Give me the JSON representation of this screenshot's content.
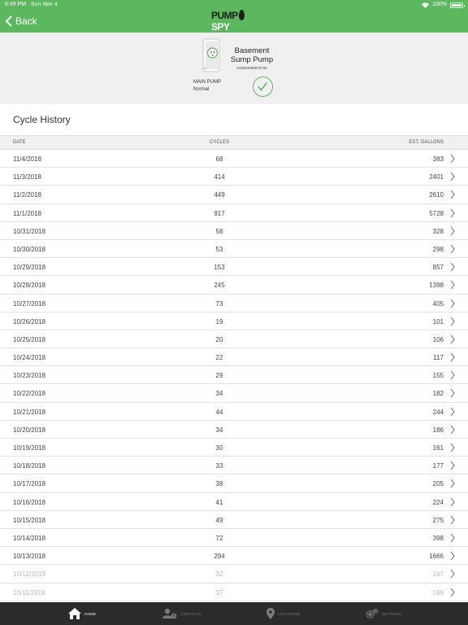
{
  "status_bar": {
    "time": "6:49 PM",
    "date": "Sun Nov 4",
    "battery": "100%"
  },
  "nav": {
    "back_label": "Back",
    "logo_left": "PUMP",
    "logo_right": "SPY"
  },
  "device": {
    "name": "Basement Sump Pump",
    "serial": "216051098975728",
    "pump_label": "MAIN PUMP",
    "pump_status": "Normal"
  },
  "section": {
    "title": "Cycle History"
  },
  "columns": {
    "date": "DATE",
    "cycles": "CYCLES",
    "gallons": "EST. GALLONS"
  },
  "rows": [
    {
      "date": "11/4/2018",
      "cycles": "68",
      "gallons": "383"
    },
    {
      "date": "11/3/2018",
      "cycles": "414",
      "gallons": "2401"
    },
    {
      "date": "11/2/2018",
      "cycles": "449",
      "gallons": "2610"
    },
    {
      "date": "11/1/2018",
      "cycles": "917",
      "gallons": "5728"
    },
    {
      "date": "10/31/2018",
      "cycles": "58",
      "gallons": "328"
    },
    {
      "date": "10/30/2018",
      "cycles": "53",
      "gallons": "298"
    },
    {
      "date": "10/29/2018",
      "cycles": "153",
      "gallons": "857"
    },
    {
      "date": "10/28/2018",
      "cycles": "245",
      "gallons": "1398"
    },
    {
      "date": "10/27/2018",
      "cycles": "73",
      "gallons": "405"
    },
    {
      "date": "10/26/2018",
      "cycles": "19",
      "gallons": "101"
    },
    {
      "date": "10/25/2018",
      "cycles": "20",
      "gallons": "106"
    },
    {
      "date": "10/24/2018",
      "cycles": "22",
      "gallons": "117"
    },
    {
      "date": "10/23/2018",
      "cycles": "29",
      "gallons": "155"
    },
    {
      "date": "10/22/2018",
      "cycles": "34",
      "gallons": "182"
    },
    {
      "date": "10/21/2018",
      "cycles": "44",
      "gallons": "244"
    },
    {
      "date": "10/20/2018",
      "cycles": "34",
      "gallons": "186"
    },
    {
      "date": "10/19/2018",
      "cycles": "30",
      "gallons": "161"
    },
    {
      "date": "10/18/2018",
      "cycles": "33",
      "gallons": "177"
    },
    {
      "date": "10/17/2018",
      "cycles": "38",
      "gallons": "205"
    },
    {
      "date": "10/16/2018",
      "cycles": "41",
      "gallons": "224"
    },
    {
      "date": "10/15/2018",
      "cycles": "49",
      "gallons": "275"
    },
    {
      "date": "10/14/2018",
      "cycles": "72",
      "gallons": "398"
    },
    {
      "date": "10/13/2018",
      "cycles": "294",
      "gallons": "1666"
    },
    {
      "date": "10/12/2018",
      "cycles": "32",
      "gallons": "167"
    },
    {
      "date": "10/11/2018",
      "cycles": "37",
      "gallons": "199"
    }
  ],
  "tabs": [
    {
      "label": "HOME",
      "icon": "home-icon",
      "active": true
    },
    {
      "label": "CONTACTS",
      "icon": "contacts-icon",
      "active": false
    },
    {
      "label": "LOCATIONS",
      "icon": "location-pin-icon",
      "active": false
    },
    {
      "label": "SETTINGS",
      "icon": "gear-icon",
      "active": false
    }
  ],
  "colors": {
    "brand_green": "#5cb85c",
    "tabbar_bg": "#2b2b2b",
    "header_bg": "#f0f0f0"
  }
}
